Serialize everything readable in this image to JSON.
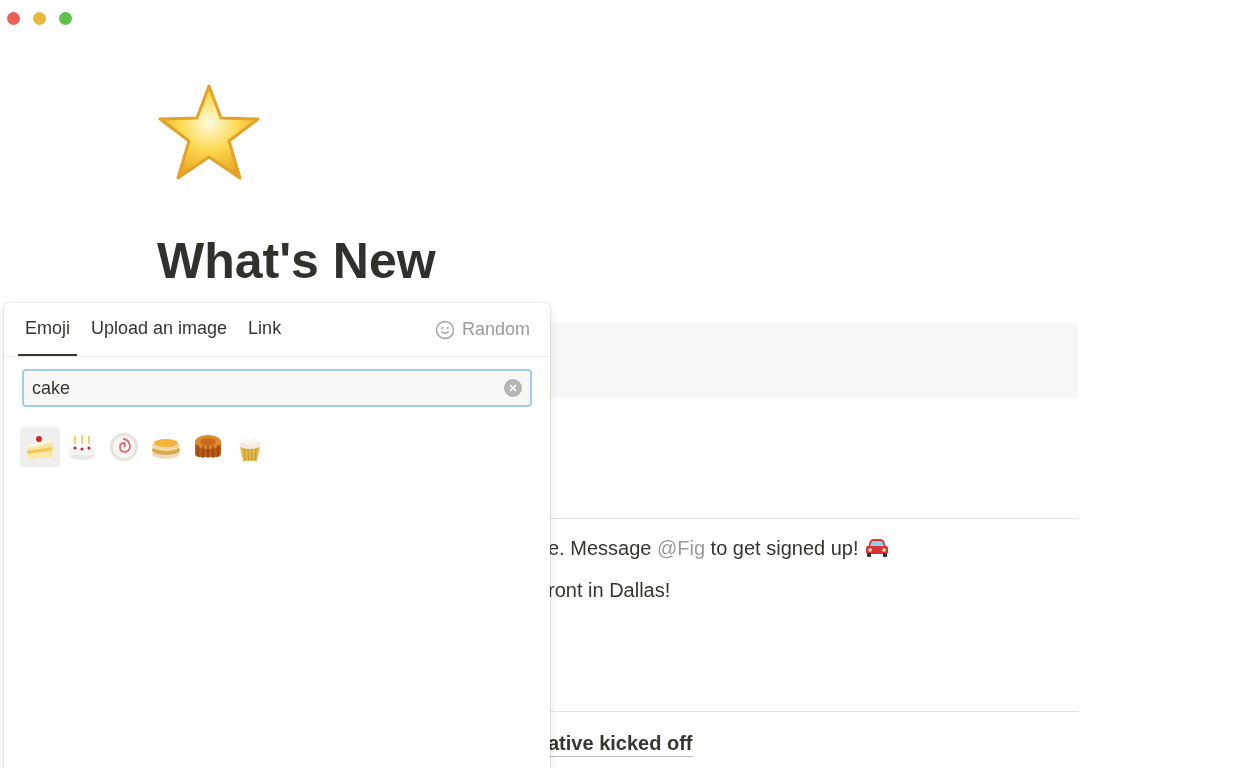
{
  "page": {
    "title": "What's New",
    "lines": [
      {
        "kind": "plain",
        "parts": [
          {
            "kind": "text",
            "text": "e. Message "
          },
          {
            "kind": "mention",
            "text": "@Fig"
          },
          {
            "kind": "text",
            "text": " to get signed up!"
          },
          {
            "kind": "car"
          }
        ]
      },
      {
        "kind": "plain",
        "parts": [
          {
            "kind": "text",
            "text": "ront in Dallas!"
          }
        ]
      },
      {
        "kind": "heading",
        "parts": [
          {
            "kind": "text",
            "text": "ative kicked off"
          }
        ]
      }
    ]
  },
  "picker": {
    "tabs": [
      {
        "label": "Emoji",
        "selected": true
      },
      {
        "label": "Upload an image",
        "selected": false
      },
      {
        "label": "Link",
        "selected": false
      }
    ],
    "random": "Random",
    "search": {
      "value": "cake"
    },
    "emojis": [
      {
        "kind": "cake-slice",
        "selected": true
      },
      {
        "kind": "birthday-cake",
        "selected": false
      },
      {
        "kind": "fish-cake",
        "selected": false
      },
      {
        "kind": "pancakes",
        "selected": false
      },
      {
        "kind": "mooncake",
        "selected": false
      },
      {
        "kind": "cupcake",
        "selected": false
      }
    ]
  }
}
